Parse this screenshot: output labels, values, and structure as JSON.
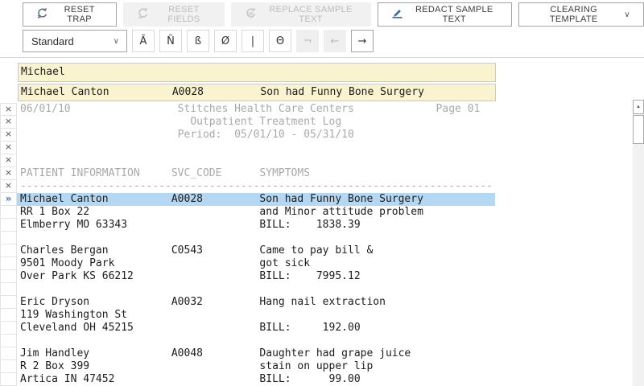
{
  "colors": {
    "trap_yellow": "#faf3d0",
    "selection_blue": "#b4d7f3",
    "muted_text": "#a9a9a9",
    "body_text": "#1c1c1c",
    "current_marker_blue": "#3f6fae",
    "redact_icon_blue": "#3c6d9e"
  },
  "icons": {
    "chevron_down": "∨",
    "scroll_up_arrow": "▲"
  },
  "toolbar": {
    "buttons": [
      {
        "label": "RESET TRAP",
        "enabled": true
      },
      {
        "label": "RESET FIELDS",
        "enabled": false
      },
      {
        "label": "REPLACE SAMPLE TEXT",
        "enabled": false
      },
      {
        "label": "REDACT SAMPLE TEXT",
        "enabled": true
      },
      {
        "label": "CLEARING TEMPLATE",
        "enabled": true
      }
    ]
  },
  "trap_bar": {
    "trap_type_selected": "Standard",
    "char_buttons": [
      {
        "name": "a-tilde",
        "glyph": "Ã",
        "enabled": true
      },
      {
        "name": "n-tilde",
        "glyph": "Ñ",
        "enabled": true
      },
      {
        "name": "sharp-s",
        "glyph": "ß",
        "enabled": true
      },
      {
        "name": "o-slash",
        "glyph": "Ø",
        "enabled": true
      },
      {
        "name": "pipe",
        "glyph": "|",
        "enabled": true
      },
      {
        "name": "theta",
        "glyph": "Θ",
        "enabled": true
      },
      {
        "name": "not-sign",
        "glyph": "¬",
        "enabled": false
      },
      {
        "name": "arrow-left",
        "glyph": "←",
        "enabled": false
      },
      {
        "name": "arrow-right",
        "glyph": "→",
        "enabled": true
      }
    ]
  },
  "trap_editor": {
    "trap_input": "Michael",
    "sample_line": "Michael Canton          A0028         Son had Funny Bone Surgery"
  },
  "report": {
    "lines": [
      {
        "gutter": "×",
        "tone": "muted",
        "selected": false,
        "text": "06/01/10                 Stitches Health Care Centers             Page 01"
      },
      {
        "gutter": "×",
        "tone": "muted",
        "selected": false,
        "text": "                           Outpatient Treatment Log"
      },
      {
        "gutter": "×",
        "tone": "muted",
        "selected": false,
        "text": "                         Period:  05/01/10 - 05/31/10"
      },
      {
        "gutter": "×",
        "tone": "muted",
        "selected": false,
        "text": ""
      },
      {
        "gutter": "×",
        "tone": "muted",
        "selected": false,
        "text": ""
      },
      {
        "gutter": "×",
        "tone": "muted",
        "selected": false,
        "text": "PATIENT INFORMATION     SVC_CODE      SYMPTOMS"
      },
      {
        "gutter": "×",
        "tone": "muted",
        "selected": false,
        "text": "---------------------------------------------------------------------------"
      },
      {
        "gutter": "»",
        "tone": "body",
        "selected": true,
        "text": "Michael Canton          A0028         Son had Funny Bone Surgery"
      },
      {
        "gutter": "",
        "tone": "body",
        "selected": false,
        "text": "RR 1 Box 22                           and Minor attitude problem"
      },
      {
        "gutter": "",
        "tone": "body",
        "selected": false,
        "text": "Elmberry MO 63343                     BILL:    1838.39"
      },
      {
        "gutter": "",
        "tone": "body",
        "selected": false,
        "text": ""
      },
      {
        "gutter": "",
        "tone": "body",
        "selected": false,
        "text": "Charles Bergan          C0543         Came to pay bill &"
      },
      {
        "gutter": "",
        "tone": "body",
        "selected": false,
        "text": "9501 Moody Park                       got sick"
      },
      {
        "gutter": "",
        "tone": "body",
        "selected": false,
        "text": "Over Park KS 66212                    BILL:    7995.12"
      },
      {
        "gutter": "",
        "tone": "body",
        "selected": false,
        "text": ""
      },
      {
        "gutter": "",
        "tone": "body",
        "selected": false,
        "text": "Eric Dryson             A0032         Hang nail extraction"
      },
      {
        "gutter": "",
        "tone": "body",
        "selected": false,
        "text": "119 Washington St"
      },
      {
        "gutter": "",
        "tone": "body",
        "selected": false,
        "text": "Cleveland OH 45215                    BILL:     192.00"
      },
      {
        "gutter": "",
        "tone": "body",
        "selected": false,
        "text": ""
      },
      {
        "gutter": "",
        "tone": "body",
        "selected": false,
        "text": "Jim Handley             A0048         Daughter had grape juice"
      },
      {
        "gutter": "",
        "tone": "body",
        "selected": false,
        "text": "R 2 Box 399                           stain on upper lip"
      },
      {
        "gutter": "",
        "tone": "body",
        "selected": false,
        "text": "Artica IN 47452                       BILL:      99.00"
      }
    ]
  }
}
